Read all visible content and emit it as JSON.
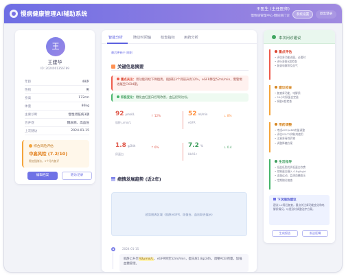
{
  "header": {
    "app_title": "慢病健康管理AI辅助系统",
    "user_name": "王医生 (主任医师)",
    "user_dept": "慢性病管理中心·糖尿病门诊",
    "btn_system": "系统设置",
    "btn_logout": "退出登录"
  },
  "patient": {
    "avatar": "王",
    "name": "王建华",
    "id": "ID: 2024001356789",
    "fields": [
      {
        "k": "年龄",
        "v": "48岁"
      },
      {
        "k": "性别",
        "v": "男"
      },
      {
        "k": "身高",
        "v": "172cm"
      },
      {
        "k": "体重",
        "v": "86kg"
      },
      {
        "k": "主要诊断",
        "v": "慢性肾脏病3期"
      },
      {
        "k": "合并症",
        "v": "糖尿病、高血压"
      },
      {
        "k": "上次随访",
        "v": "2024-01-15"
      }
    ],
    "risk_title": "综合风险评估",
    "risk_value": "中高风险 (7.2/10)",
    "risk_desc": "需加强随访，3个月内复评",
    "btn_edit": "编辑档案",
    "btn_history": "随访记录"
  },
  "main": {
    "tabs": [
      "智能分析",
      "随访时间轴",
      "检查指标",
      "用药分析"
    ],
    "refresh_link": "最后更新于 刚刚",
    "section1_title": "关键信息摘要",
    "alert_red_label": "重点关注：",
    "alert_red_text": "肾功能持续下降趋势，肌酐较3个月前升高12%，eGFR降至52ml/min，需警惕进展至CKD4期。",
    "alert_green_label": "积极变化：",
    "alert_green_text": "糖化血红蛋白控制改善，血压控制达标。",
    "metrics": [
      {
        "value": "92",
        "unit": "μmol/L",
        "label": "肌酐 μmol/L",
        "trend": "↑ 12%",
        "color": "#e05b4d"
      },
      {
        "value": "52",
        "unit": "ml/min",
        "label": "eGFR",
        "trend": "↓ 8%",
        "color": "#ff8f3e"
      },
      {
        "value": "1.8",
        "unit": "g/24h",
        "label": "尿蛋白",
        "trend": "↑ 6%",
        "color": "#e05b4d"
      },
      {
        "value": "7.2",
        "unit": "%",
        "label": "HbA1c",
        "trend": "↓ 0.4",
        "color": "#3f9e5e"
      }
    ],
    "section2_title": "病情发展趋势 (近2年)",
    "chart_text": "趋势图表区域（肌酐/eGFR、尿蛋白、血压联合展示）",
    "timeline_date": "2024-01-15",
    "timeline_text_prefix": "肌酐上升至",
    "timeline_highlight": "92μmol/L",
    "timeline_text_suffix": "，eGFR降至52ml/min，蛋白尿1.8g/24h。调整ACEI剂量，加强血糖管理。"
  },
  "right": {
    "title": "本次问诊建议",
    "recs": [
      {
        "title": "重点评估",
        "lines": [
          "• 评估肾功能进展，必要时",
          "• 进行肾脏B超检查",
          "• 复查电解质及血气"
        ]
      },
      {
        "title": "建议检查",
        "lines": [
          "• 复查肾功能、电解质",
          "• 24小时尿蛋白定量",
          "• 肾脏B超检查"
        ]
      },
      {
        "title": "用药调整",
        "lines": [
          "• 考虑ACEI/ARB剂量调整",
          "• 评估SGLT2抑制剂使用",
          "• 注意肾毒性药物",
          "• 调整降糖方案"
        ]
      },
      {
        "title": "生活指导",
        "lines": [
          "• 低盐低脂优质低蛋白饮食",
          "• 控制蛋白摄入 0.8g/kg/d",
          "• 适量运动，监测血糖血压",
          "• 定期随访复查"
        ]
      }
    ],
    "followup_title": "下次随访建议",
    "followup_text": "建议1-2周后复查，重点关注肾功能变化和电解质情况，以便及时调整治疗方案。",
    "btn_report": "生成报告",
    "btn_share": "发送医嘱"
  }
}
